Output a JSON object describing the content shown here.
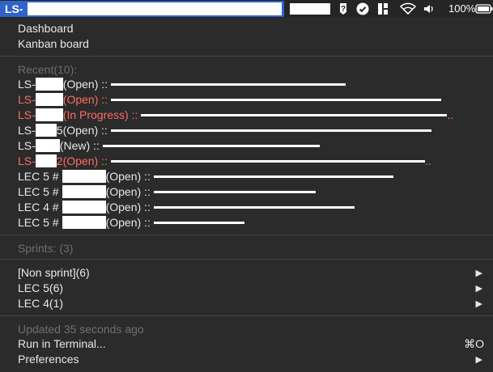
{
  "menubar": {
    "active_label": "LS-",
    "battery": "100%",
    "icons": [
      "question-badge-icon",
      "check-circle-icon",
      "columns-icon",
      "wifi-icon",
      "volume-icon",
      "battery-icon"
    ]
  },
  "menu": {
    "dashboard": "Dashboard",
    "kanban": "Kanban board",
    "recent_header": "Recent(10):",
    "recent": [
      {
        "prefix": "LS-",
        "status": "(Open) ::",
        "color": "#e8e8e8"
      },
      {
        "prefix": "LS-",
        "status": "(Open) ::",
        "color": "#ff6b63"
      },
      {
        "prefix": "LS-",
        "status": "(In Progress) ::",
        "color": "#ff6b63",
        "tail": ".."
      },
      {
        "prefix": "LS-",
        "status": "5(Open) ::",
        "color": "#e8e8e8"
      },
      {
        "prefix": "LS-",
        "status": "(New) ::",
        "color": "#e8e8e8"
      },
      {
        "prefix": "LS-",
        "status": "2(Open) ::",
        "color": "#ff6b63",
        "tail": ".."
      },
      {
        "prefix": "LEC 5 #",
        "status": "(Open) ::",
        "color": "#e8e8e8"
      },
      {
        "prefix": "LEC 5 #",
        "status": "(Open) ::",
        "color": "#e8e8e8"
      },
      {
        "prefix": "LEC 4 #",
        "status": "(Open) ::",
        "color": "#e8e8e8"
      },
      {
        "prefix": "LEC 5 #",
        "status": "(Open) ::",
        "color": "#e8e8e8"
      }
    ],
    "sprints_header": "Sprints: (3)",
    "sprints": [
      {
        "label": "[Non sprint](6)"
      },
      {
        "label": "LEC 5(6)"
      },
      {
        "label": "LEC 4(1)"
      }
    ],
    "updated": "Updated 35 seconds ago",
    "run_terminal": "Run in Terminal...",
    "run_shortcut": "⌘O",
    "preferences": "Preferences",
    "submenu_glyph": "▶"
  }
}
